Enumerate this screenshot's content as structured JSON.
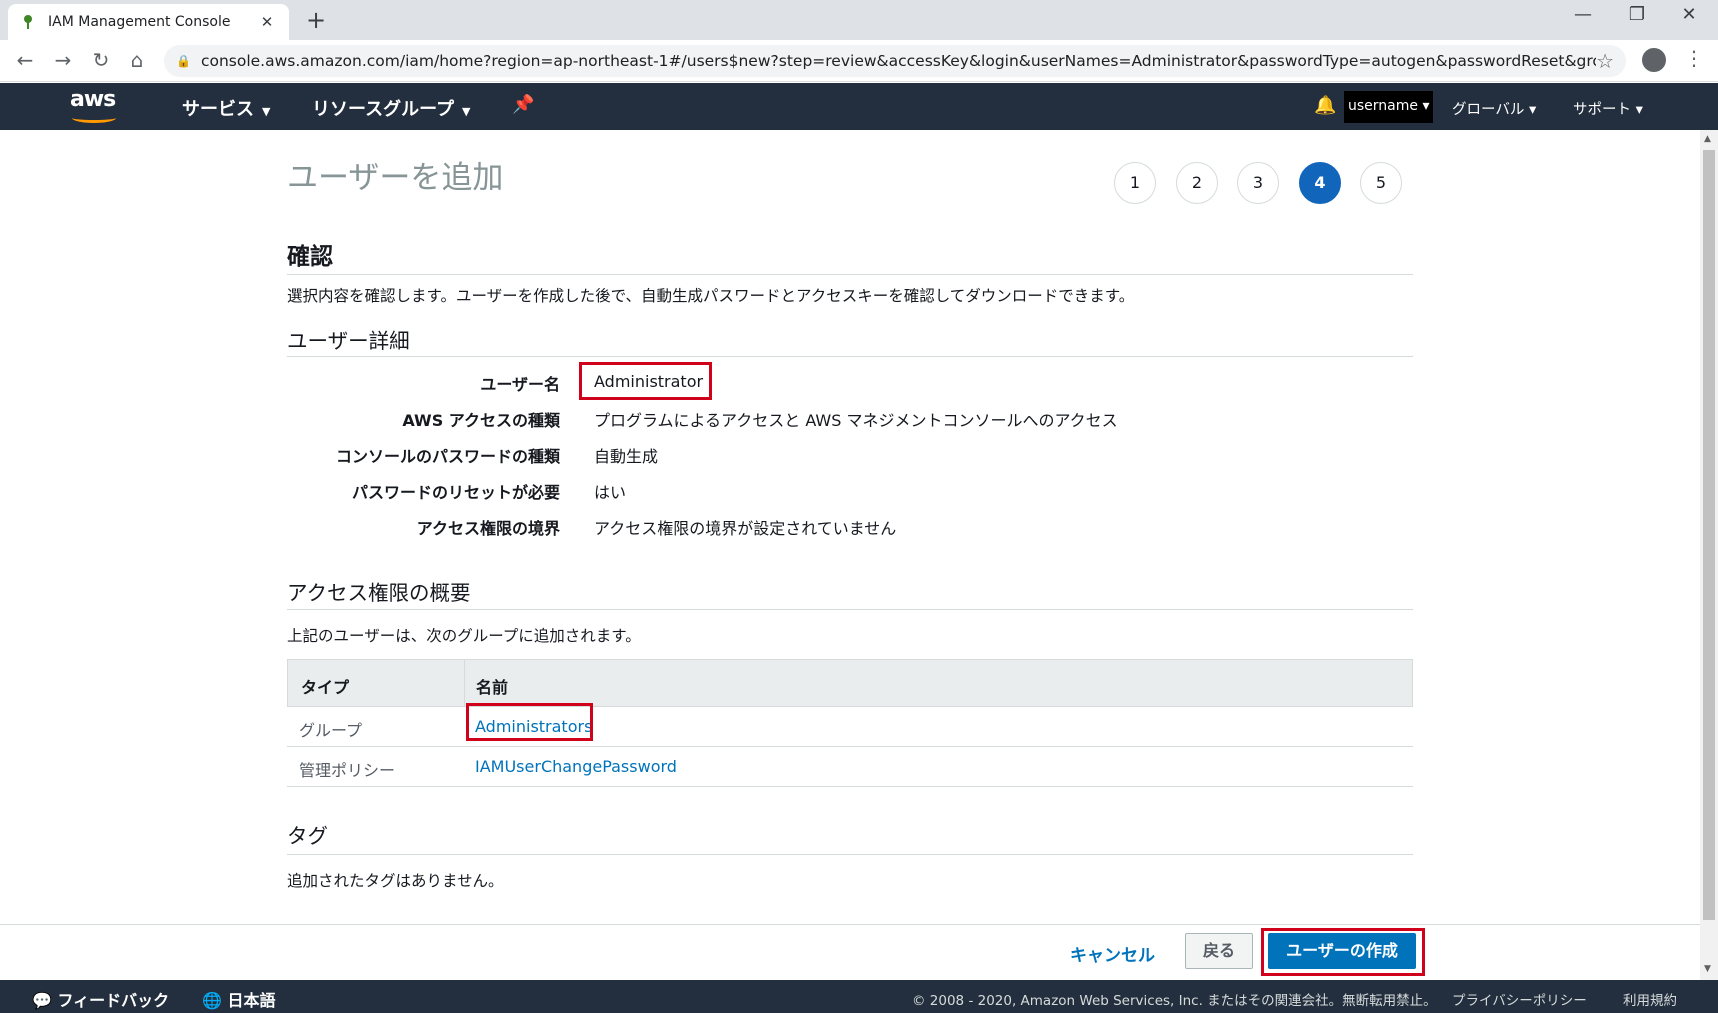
{
  "browser": {
    "tab_title": "IAM Management Console",
    "url": "console.aws.amazon.com/iam/home?region=ap-northeast-1#/users$new?step=review&accessKey&login&userNames=Administrator&passwordType=autogen&passwordReset&groups=A..."
  },
  "aws_nav": {
    "logo": "aws",
    "services": "サービス",
    "resource_groups": "リソースグループ",
    "username": "username",
    "global": "グローバル",
    "support": "サポート"
  },
  "page": {
    "title": "ユーザーを追加",
    "steps": [
      "1",
      "2",
      "3",
      "4",
      "5"
    ],
    "active_step": "4"
  },
  "review": {
    "heading": "確認",
    "description": "選択内容を確認します。ユーザーを作成した後で、自動生成パスワードとアクセスキーを確認してダウンロードできます。"
  },
  "user_details": {
    "heading": "ユーザー詳細",
    "rows": [
      {
        "label": "ユーザー名",
        "value": "Administrator"
      },
      {
        "label": "AWS アクセスの種類",
        "value": "プログラムによるアクセスと AWS マネジメントコンソールへのアクセス"
      },
      {
        "label": "コンソールのパスワードの種類",
        "value": "自動生成"
      },
      {
        "label": "パスワードのリセットが必要",
        "value": "はい"
      },
      {
        "label": "アクセス権限の境界",
        "value": "アクセス権限の境界が設定されていません"
      }
    ]
  },
  "permissions": {
    "heading": "アクセス権限の概要",
    "description": "上記のユーザーは、次のグループに追加されます。",
    "columns": [
      "タイプ",
      "名前"
    ],
    "rows": [
      {
        "type": "グループ",
        "name": "Administrators"
      },
      {
        "type": "管理ポリシー",
        "name": "IAMUserChangePassword"
      }
    ]
  },
  "tags": {
    "heading": "タグ",
    "description": "追加されたタグはありません。"
  },
  "actions": {
    "cancel": "キャンセル",
    "back": "戻る",
    "create": "ユーザーの作成"
  },
  "footer": {
    "feedback": "フィードバック",
    "language": "日本語",
    "copyright": "© 2008 - 2020, Amazon Web Services, Inc. またはその関連会社。無断転用禁止。",
    "privacy": "プライバシーポリシー",
    "terms": "利用規約"
  },
  "colors": {
    "aws_nav_bg": "#232f3e",
    "accent_blue": "#0073bb",
    "highlight_red": "#d0011b",
    "aws_orange": "#ff9900"
  }
}
